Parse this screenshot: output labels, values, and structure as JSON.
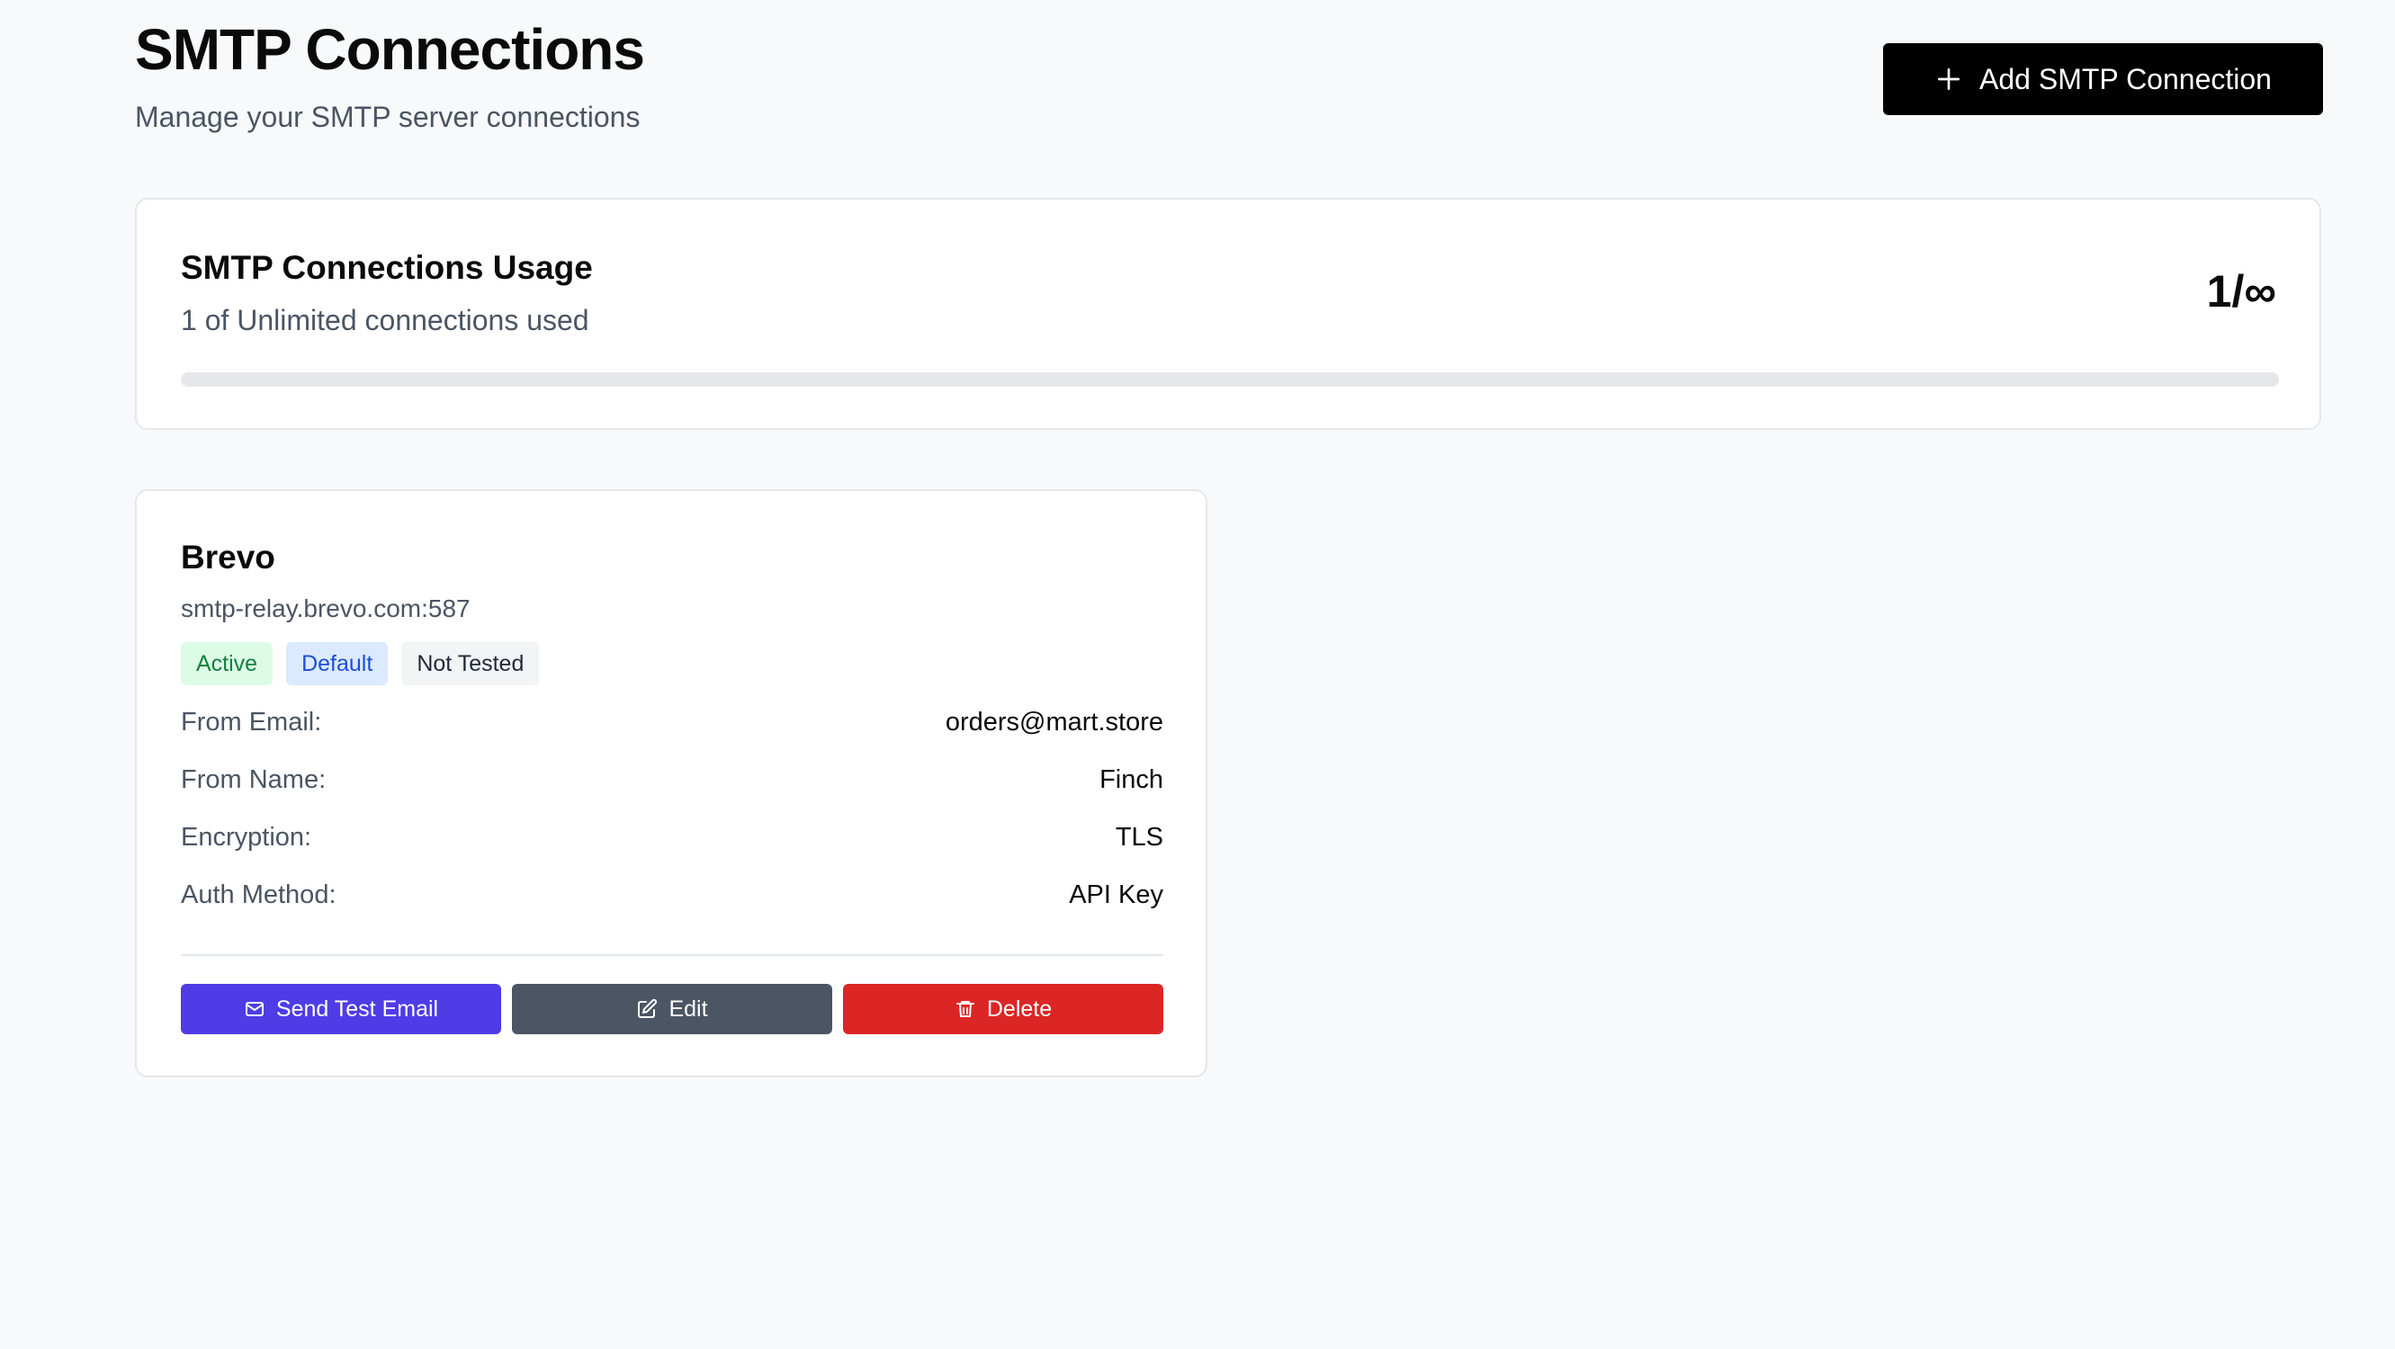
{
  "header": {
    "title": "SMTP Connections",
    "subtitle": "Manage your SMTP server connections",
    "add_button_label": "Add SMTP Connection"
  },
  "usage": {
    "title": "SMTP Connections Usage",
    "description": "1 of Unlimited connections used",
    "count_display": "1/∞",
    "used": 1,
    "limit": "Unlimited",
    "progress_fraction": 0
  },
  "connection": {
    "name": "Brevo",
    "host": "smtp-relay.brevo.com:587",
    "badges": {
      "active": "Active",
      "default": "Default",
      "test_status": "Not Tested"
    },
    "details": [
      {
        "label": "From Email:",
        "value": "orders@mart.store"
      },
      {
        "label": "From Name:",
        "value": "Finch"
      },
      {
        "label": "Encryption:",
        "value": "TLS"
      },
      {
        "label": "Auth Method:",
        "value": "API Key"
      }
    ],
    "actions": {
      "send_test": "Send Test Email",
      "edit": "Edit",
      "delete": "Delete"
    }
  },
  "colors": {
    "primary_button": "#000000",
    "send_button": "#4f3ce6",
    "edit_button": "#4b5563",
    "delete_button": "#dc2626",
    "active_badge": "#dcfce7",
    "default_badge": "#dbeafe"
  }
}
